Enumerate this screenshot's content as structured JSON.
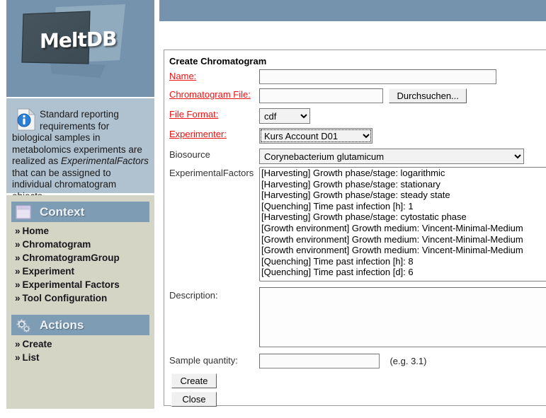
{
  "brand": {
    "logo_text": "MeltDB"
  },
  "info": {
    "icon": "info-document-icon",
    "text_part1": "Standard reporting requirements for biological samples in metabolomics experiments are realized as ",
    "emphasis": "ExperimentalFactors",
    "text_part2": " that can be assigned to individual chromatogram objects."
  },
  "sidebar": {
    "context": {
      "icon": "window-icon",
      "title": "Context",
      "items": [
        {
          "label": "Home"
        },
        {
          "label": "Chromatogram"
        },
        {
          "label": "ChromatogramGroup"
        },
        {
          "label": "Experiment"
        },
        {
          "label": "Experimental Factors"
        },
        {
          "label": "Tool Configuration"
        }
      ]
    },
    "actions": {
      "icon": "gears-icon",
      "title": "Actions",
      "items": [
        {
          "label": "Create"
        },
        {
          "label": "List"
        }
      ]
    },
    "chevron": "»"
  },
  "form": {
    "title": "Create Chromatogram",
    "name": {
      "label": "Name:",
      "value": "",
      "placeholder": ""
    },
    "chromatogram_file": {
      "label": "Chromatogram File:",
      "value": "",
      "browse_label": "Durchsuchen..."
    },
    "file_format": {
      "label": "File Format:",
      "value": "cdf",
      "options": [
        "cdf"
      ]
    },
    "experimenter": {
      "label": "Experimenter:",
      "value": "Kurs Account D01",
      "options": [
        "Kurs Account D01"
      ]
    },
    "biosource": {
      "label": "Biosource",
      "value": "Corynebacterium glutamicum",
      "options": [
        "Corynebacterium glutamicum"
      ]
    },
    "experimental_factors": {
      "label": "ExperimentalFactors",
      "options": [
        "[Harvesting] Growth phase/stage: logarithmic",
        "[Harvesting] Growth phase/stage: stationary",
        "[Harvesting] Growth phase/stage: steady state",
        "[Quenching] Time past infection [h]: 1",
        "[Harvesting] Growth phase/stage: cytostatic phase",
        "[Growth environment] Growth medium: Vincent-Minimal-Medium",
        "[Growth environment] Growth medium: Vincent-Minimal-Medium",
        "[Growth environment] Growth medium: Vincent-Minimal-Medium",
        "[Quenching] Time past infection [h]: 8",
        "[Quenching] Time past infection [d]: 6"
      ]
    },
    "description": {
      "label": "Description:",
      "value": ""
    },
    "sample_quantity": {
      "label": "Sample quantity:",
      "value": "",
      "hint": "(e.g. 3.1)"
    },
    "create_button": "Create",
    "close_button": "Close"
  },
  "colors": {
    "brand_blue": "#7593ac",
    "info_bg": "#b0c1d0",
    "sidebar_bg": "#d5d5c6",
    "section_header": "#7e9cb4",
    "required_label": "#ee1111"
  }
}
